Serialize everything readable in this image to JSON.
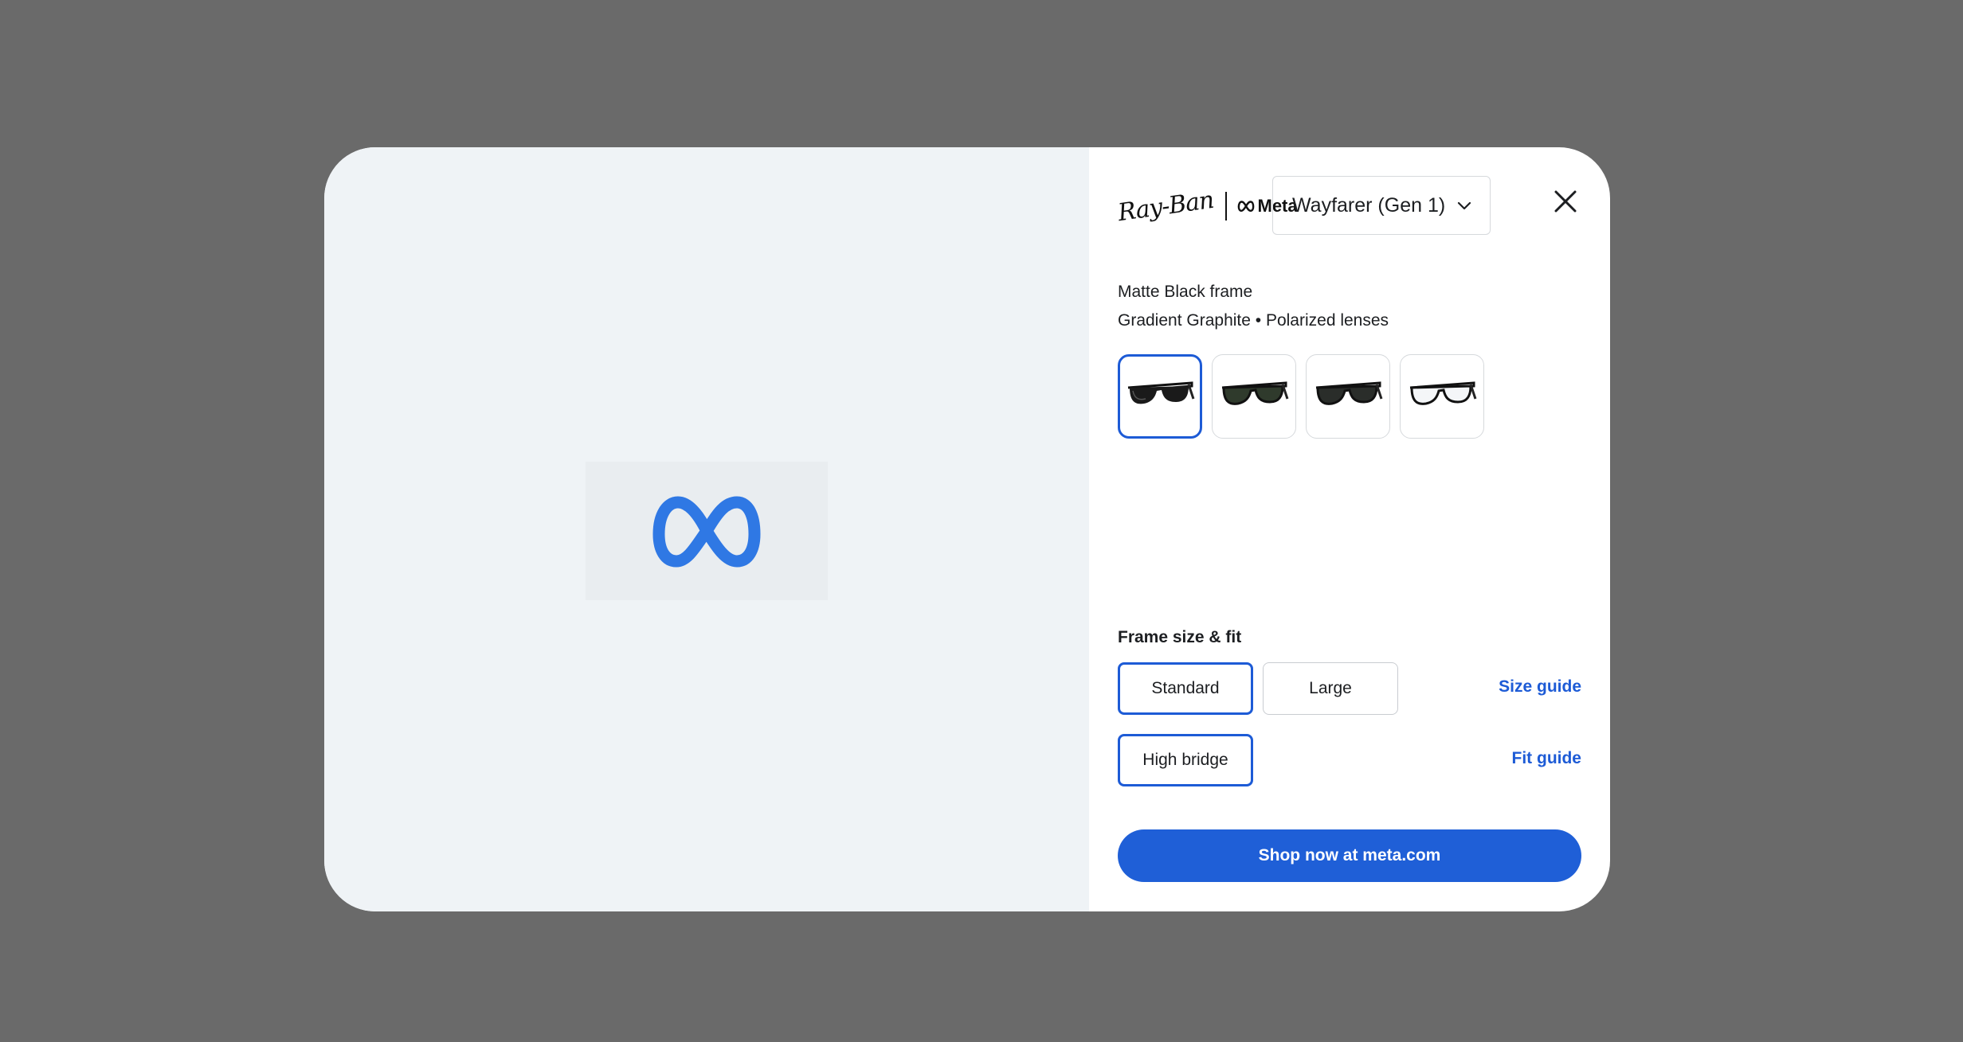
{
  "brand": {
    "rayban_text": "Ray-Ban",
    "meta_text": "Meta"
  },
  "model_select": {
    "value": "Wayfarer (Gen 1)",
    "icon": "chevron-down-icon"
  },
  "close": {
    "icon": "close-icon"
  },
  "product": {
    "frame": "Matte Black frame",
    "lenses": "Gradient Graphite • Polarized lenses"
  },
  "swatches": [
    {
      "icon": "sunglasses-dark-icon",
      "selected": true
    },
    {
      "icon": "sunglasses-green-icon",
      "selected": false
    },
    {
      "icon": "sunglasses-graphite-icon",
      "selected": false
    },
    {
      "icon": "glasses-clear-icon",
      "selected": false
    }
  ],
  "fit": {
    "title": "Frame size & fit",
    "sizes": [
      "Standard",
      "Large"
    ],
    "selected_size": "Standard",
    "size_guide": "Size guide",
    "bridge": "High bridge",
    "fit_guide": "Fit guide"
  },
  "cta": {
    "label": "Shop now at meta.com"
  },
  "colors": {
    "accent": "#1d5bd6",
    "cta_bg": "#1f5fd7",
    "meta_logo": "#2f78e4",
    "overlay": "#6a6a6a",
    "preview_bg": "#eff3f6"
  }
}
